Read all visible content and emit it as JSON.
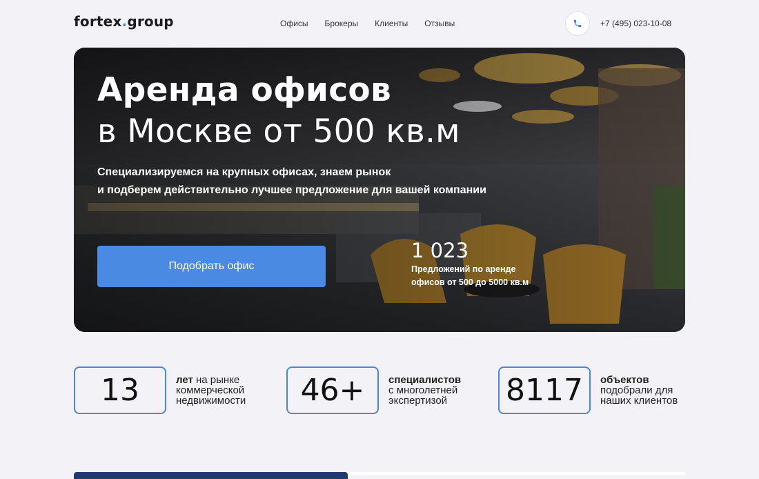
{
  "header": {
    "logo": {
      "part1": "fortex",
      "dot": ".",
      "part2": "group"
    },
    "nav": [
      "Офисы",
      "Брокеры",
      "Клиенты",
      "Отзывы"
    ],
    "phone": "+7 (495) 023-10-08"
  },
  "hero": {
    "title_line1": "Аренда офисов",
    "title_line2": "в Москве от 500 кв.м",
    "subtitle_line1": "Специализируемся на крупных офисах, знаем рынок",
    "subtitle_line2": "и подберем действительно лучшее предложение для вашей компании",
    "cta_label": "Подобрать офис",
    "offers_count": "1 023",
    "offers_desc_line1": "Предложений по аренде",
    "offers_desc_line2": "офисов от 500 до 5000 кв.м"
  },
  "stats": [
    {
      "value": "13",
      "bold": "лет",
      "rest1": " на рынке",
      "rest2": "коммерческой",
      "rest3": "недвижимости"
    },
    {
      "value": "46+",
      "bold": "специалистов",
      "rest1": "",
      "rest2": "с многолетней",
      "rest3": "экспертизой"
    },
    {
      "value": "8117",
      "bold": "объектов",
      "rest1": "",
      "rest2": "подобрали для",
      "rest3": "наших клиентов"
    }
  ],
  "colors": {
    "accent": "#4a8ae3",
    "background": "#f2f2f7",
    "dark_navy": "#1f3a6b"
  },
  "icons": {
    "phone": "phone-icon"
  }
}
